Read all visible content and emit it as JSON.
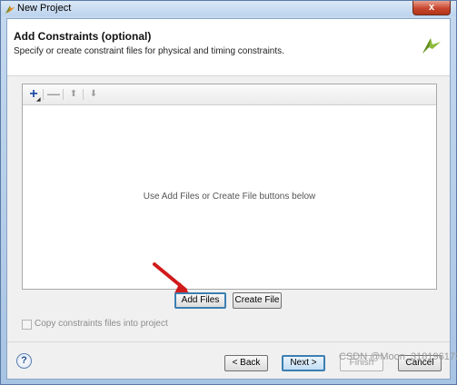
{
  "window": {
    "title": "New Project",
    "close_label": "x"
  },
  "header": {
    "title": "Add Constraints (optional)",
    "subtitle": "Specify or create constraint files for physical and timing constraints.",
    "logo_icon": "vivado-leaf-icon"
  },
  "toolbar": {
    "add_icon": "plus-icon",
    "remove_icon": "minus-icon",
    "up_icon": "arrow-up-icon",
    "down_icon": "arrow-down-icon"
  },
  "file_list": {
    "empty_hint": "Use Add Files or Create File buttons below"
  },
  "buttons": {
    "add_files": "Add Files",
    "create_file": "Create File"
  },
  "copy_option": {
    "label": "Copy constraints files into project",
    "checked": false
  },
  "footer": {
    "help": "?",
    "back": "< Back",
    "next": "Next >",
    "finish": "Finish",
    "cancel": "Cancel"
  },
  "watermark": "CSDN @Moon_3181961725",
  "colors": {
    "accent": "#3c7fb1",
    "plus": "#1f4fa8",
    "arrow": "#d11b1b"
  }
}
